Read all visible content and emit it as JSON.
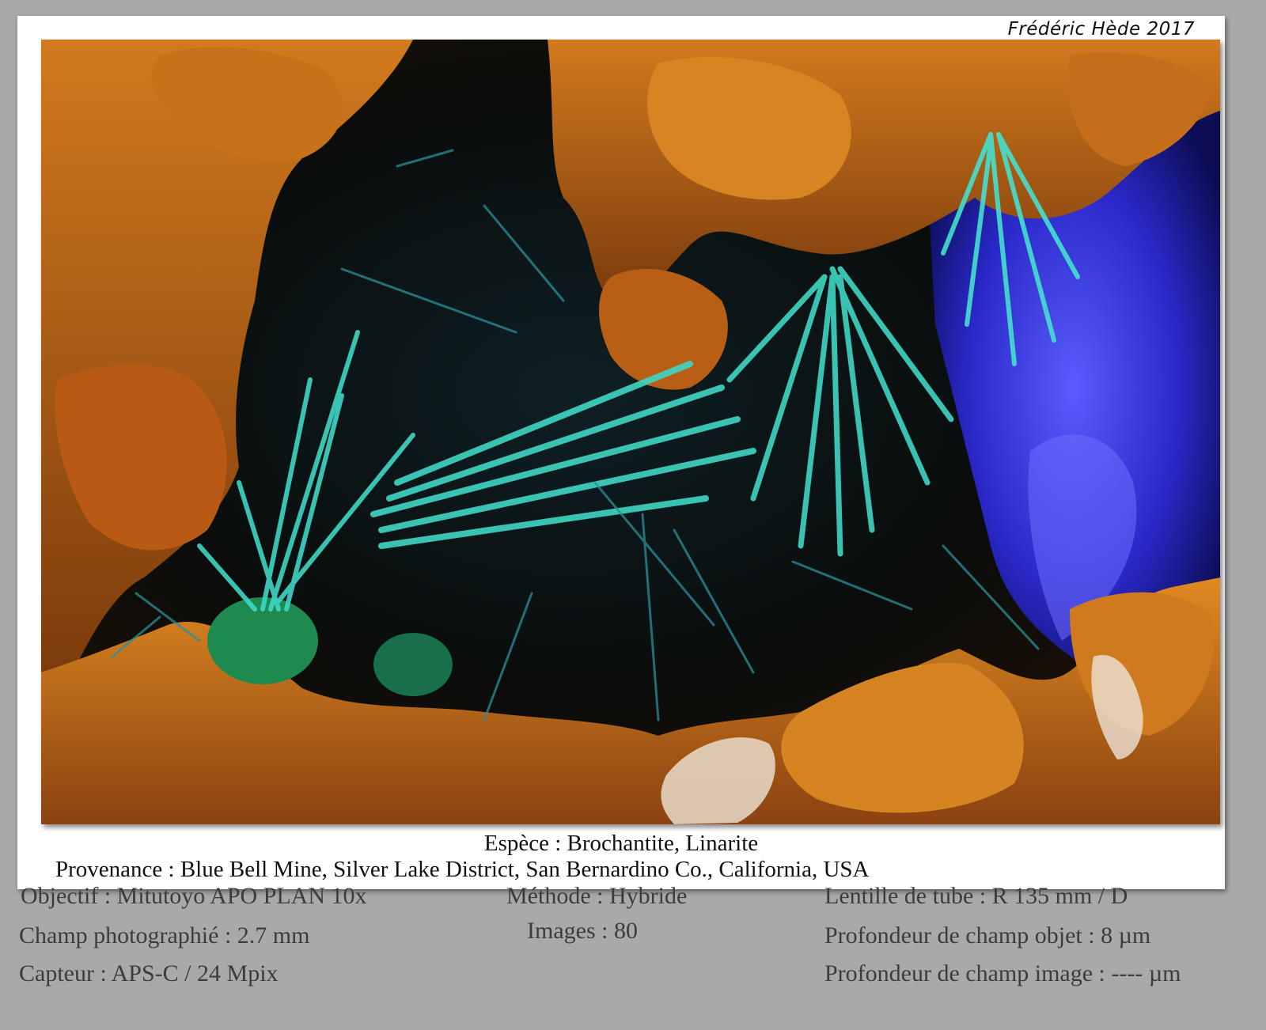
{
  "signature": "Frédéric Hède 2017",
  "caption": {
    "species": "Espèce : Brochantite, Linarite",
    "origin": "Provenance : Blue Bell Mine, Silver Lake District, San Bernardino Co., California, USA"
  },
  "specs": {
    "objective": "Objectif : Mitutoyo APO PLAN 10x",
    "field": "Champ photographié : 2.7 mm",
    "sensor": "Capteur : APS-C / 24 Mpix",
    "method": "Méthode : Hybride",
    "images": "Images : 80",
    "tube_lens": "Lentille de tube : R 135 mm / D",
    "object_dof": "Profondeur de champ objet : 8 µm",
    "image_dof": "Profondeur de champ image : ---- µm"
  },
  "colors": {
    "background": "#a9a9a9",
    "frame": "#ffffff",
    "matrix_orange": "#c06a18",
    "brochantite_teal": "#3fd6c4",
    "linarite_blue": "#3a3ae0"
  }
}
